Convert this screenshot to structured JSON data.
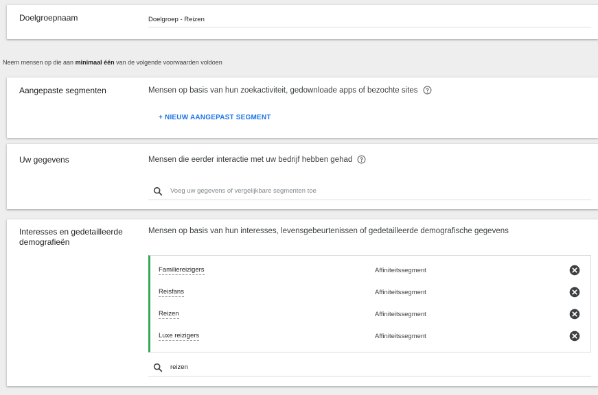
{
  "audience_name": {
    "label": "Doelgroepnaam",
    "value": "Doelgroep - Reizen"
  },
  "conditions": {
    "prefix": "Neem mensen op die aan ",
    "emphasis": "minimaal één",
    "suffix": " van de volgende voorwaarden voldoen"
  },
  "custom_segments": {
    "label": "Aangepaste segmenten",
    "description": "Mensen op basis van hun zoekactiviteit, gedownloade apps of bezochte sites",
    "new_button": "+ NIEUW AANGEPAST SEGMENT"
  },
  "your_data": {
    "label": "Uw gegevens",
    "description": "Mensen die eerder interactie met uw bedrijf hebben gehad",
    "search_placeholder": "Voeg uw gegevens of vergelijkbare segmenten toe"
  },
  "interests": {
    "label": "Interesses en gedetailleerde demografieën",
    "description": "Mensen op basis van hun interesses, levensgebeurtenissen of gedetailleerde demografische gegevens",
    "segments": [
      {
        "name": "Familiereizigers",
        "type": "Affiniteitssegment"
      },
      {
        "name": "Reisfans",
        "type": "Affiniteitssegment"
      },
      {
        "name": "Reizen",
        "type": "Affiniteitssegment"
      },
      {
        "name": "Luxe reizigers",
        "type": "Affiniteitssegment"
      }
    ],
    "search_value": "reizen"
  },
  "colors": {
    "accent_blue": "#1a73e8",
    "selected_border_green": "#34a853",
    "background": "#eeeeee"
  },
  "icons": {
    "help": "help-circle-icon",
    "search": "search-icon",
    "remove": "close-circle-icon"
  }
}
